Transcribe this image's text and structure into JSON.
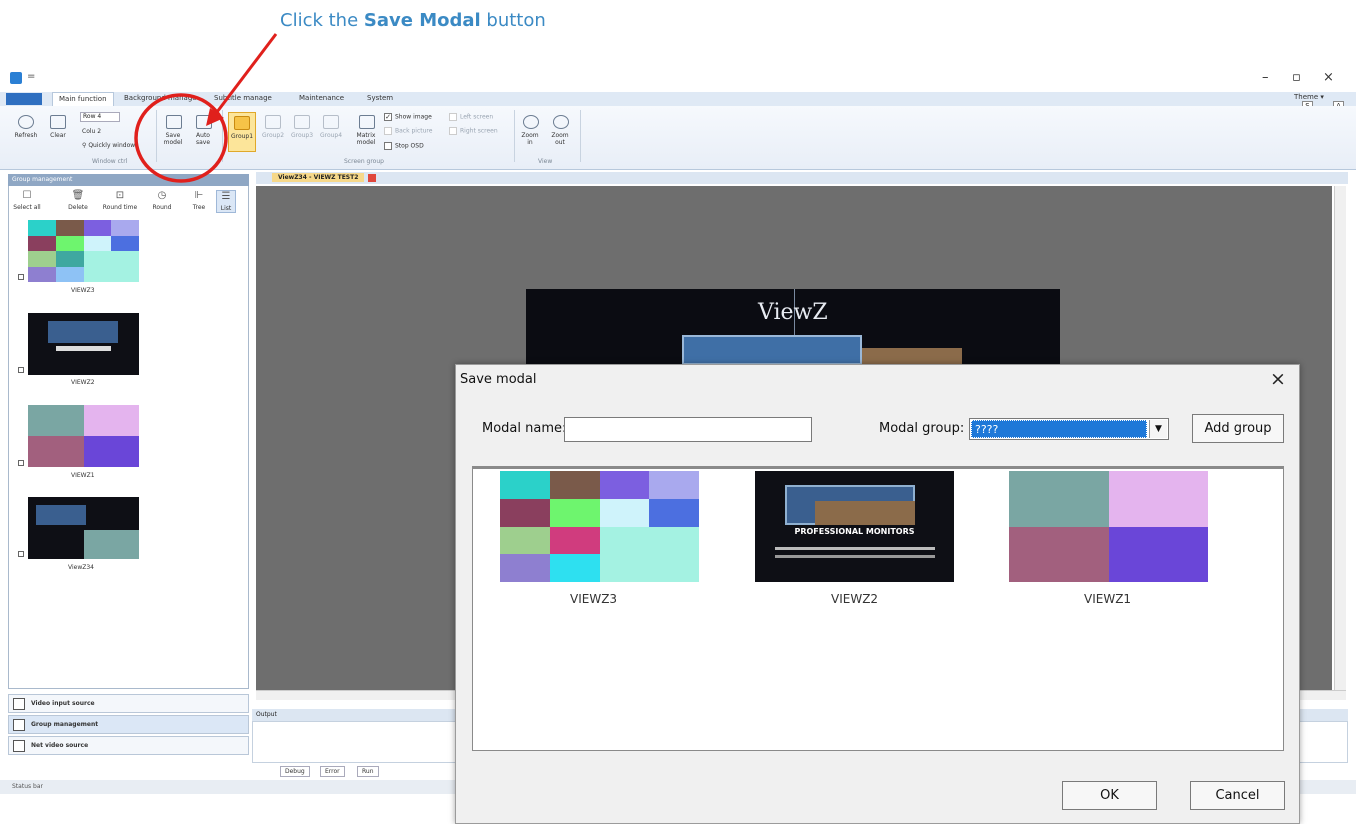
{
  "annotation": {
    "prefix": "Click the ",
    "bold": "Save Modal",
    "suffix": " button",
    "color": "#3b8ac4",
    "highlight_color": "#e0201c"
  },
  "window": {
    "quick_access": "=",
    "minimize": "–",
    "restore": "▫",
    "close": "×"
  },
  "ribbon": {
    "tabs": [
      "Main function",
      "Background manage",
      "Subtitle manage",
      "Maintenance",
      "System"
    ],
    "active_tab": 0,
    "theme_label": "Theme ▾",
    "theme_boxes": [
      "S",
      "A"
    ],
    "buttons": {
      "refresh": "Refresh",
      "clear": "Clear",
      "row_label": "Row 4",
      "col_label": "Colu 2",
      "quickly_window": "Quickly window",
      "save_model": "Save model",
      "auto_save": "Auto save",
      "group1": "Group1",
      "group2": "Group2",
      "group3": "Group3",
      "group4": "Group4",
      "matrix_model": "Matrix model",
      "show_image": "Show image",
      "back_picture": "Back picture",
      "stop_osd": "Stop OSD",
      "left_screen": "Left screen",
      "right_screen": "Right screen",
      "zoom_in": "Zoom in",
      "zoom_out": "Zoom out"
    },
    "groups": {
      "window": "Window ctrl",
      "screen": "Screen group",
      "view": "View"
    }
  },
  "left_panel": {
    "header": "Group management",
    "tools": [
      "Select all",
      "Delete",
      "Round time",
      "Round",
      "Tree",
      "List"
    ],
    "thumbnails": [
      "VIEWZ3",
      "VIEWZ2",
      "VIEWZ1",
      "ViewZ34"
    ],
    "bottom_items": [
      "Video input source",
      "Group management",
      "Net video source"
    ]
  },
  "document": {
    "tab": "ViewZ34 - VIEWZ TEST2",
    "preview_logo": "ViewZ"
  },
  "output": {
    "label": "Output",
    "tabs": [
      "Debug",
      "Error",
      "Run"
    ]
  },
  "status_bar": "Status bar",
  "modal": {
    "title": "Save modal",
    "name_label": "Modal name:",
    "name_value": "",
    "group_label": "Modal group:",
    "group_value": "????",
    "add_group": "Add group",
    "thumbnails": [
      "VIEWZ3",
      "VIEWZ2",
      "VIEWZ1"
    ],
    "thumb2_caption": "PROFESSIONAL MONITORS",
    "ok": "OK",
    "cancel": "Cancel"
  }
}
